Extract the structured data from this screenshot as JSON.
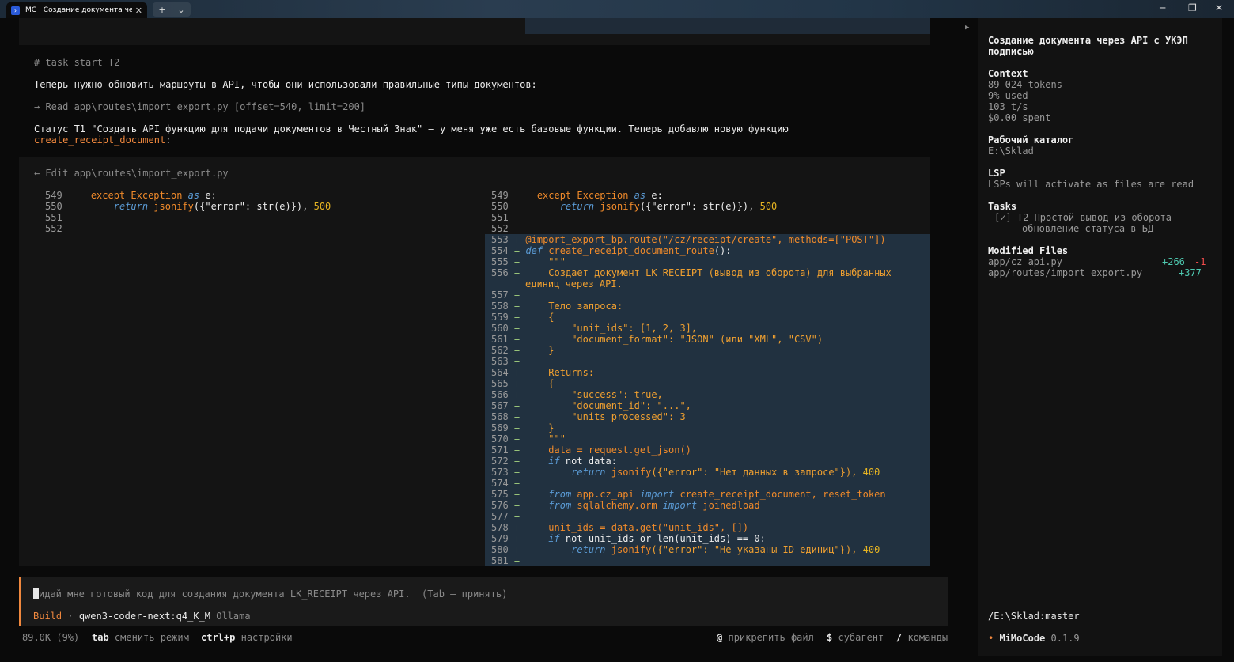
{
  "window": {
    "tab_title": "MC | Создание документа чер",
    "tab_close": "✕",
    "new_tab": "+",
    "dropdown": "⌄",
    "minimize": "─",
    "maximize": "❐",
    "close": "✕"
  },
  "chat": {
    "task_start": "# task start T2",
    "msg1": "Теперь нужно обновить маршруты в API, чтобы они использовали правильные типы документов:",
    "read_line": "→ Read app\\routes\\import_export.py [offset=540, limit=200]",
    "status_line": "Статус T1 \"Создать API функцию для подачи документов в Честный Знак\" — у меня уже есть базовые функции. Теперь добавлю новую функцию",
    "status_fn": "create_receipt_document",
    "status_colon": ":",
    "edit_header": "← Edit app\\routes\\import_export.py"
  },
  "diff": {
    "left_nums": [
      "549",
      "550",
      "551",
      "552"
    ],
    "right_nums": [
      "549",
      "550",
      "551",
      "552"
    ],
    "added_lines": [
      "553",
      "554",
      "555",
      "556",
      "",
      "557",
      "558",
      "559",
      "560",
      "561",
      "562",
      "563",
      "564",
      "565",
      "566",
      "567",
      "568",
      "569",
      "570",
      "571",
      "572",
      "573",
      "574",
      "575",
      "576",
      "577",
      "578",
      "579",
      "580",
      "581"
    ],
    "plus": "+",
    "exc_kw": "except",
    "exc_type": "Exception",
    "as_kw": "as",
    "exc_var": "e:",
    "ret_kw": "return",
    "jsonify": "jsonify",
    "err_tail": "({\"error\": str(e)}), ",
    "code500": "500",
    "decorator": "@import_export_bp.route(\"/cz/receipt/create\", methods=[\"POST\"])",
    "def_kw": "def",
    "def_name": "create_receipt_document_route",
    "def_tail": "():",
    "doc_q": "\"\"\"",
    "doc1": "Создает документ LK_RECEIPT (вывод из оборота) для выбранных",
    "doc1b": "единиц через API.",
    "doc_body": "Тело запроса:",
    "brace_open": "{",
    "unit_ids": "\"unit_ids\": [1, 2, 3],",
    "doc_format": "\"document_format\": \"JSON\" (или \"XML\", \"CSV\")",
    "brace_close": "}",
    "returns": "Returns:",
    "success": "\"success\": true,",
    "document_id": "\"document_id\": \"...\",",
    "units_processed": "\"units_processed\": 3",
    "data_assign": "data = request.get_json()",
    "if_kw": "if",
    "not_data": " not data:",
    "err_nodata": "({\"error\": \"Нет данных в запросе\"}), ",
    "code400": "400",
    "from_kw": "from",
    "import_kw": "import",
    "imp1_mod": " app.cz_api ",
    "imp1_names": " create_receipt_document, reset_token",
    "imp2_mod": " sqlalchemy.orm ",
    "imp2_names": " joinedload",
    "unit_ids_assign": "unit_ids = data.get(\"unit_ids\", [])",
    "if_unit": " not unit_ids or len(unit_ids) == 0:",
    "err_noids": "({\"error\": \"Не указаны ID единиц\"}), "
  },
  "input": {
    "typed_first": "К",
    "placeholder": "идай мне готовый код для создания документа LK_RECEIPT через API.  (Tab — принять)",
    "mode": "Build",
    "sep": "·",
    "model": "qwen3-coder-next:q4_K_M",
    "provider": "Ollama"
  },
  "footer": {
    "usage": "89.0K (9%)",
    "k_tab": "tab",
    "t_tab": "сменить режим",
    "k_ctrl": "ctrl+p",
    "t_ctrl": "настройки",
    "k_at": "@",
    "t_at": "прикрепить файл",
    "k_dollar": "$",
    "t_dollar": "субагент",
    "k_slash": "/",
    "t_slash": "команды"
  },
  "sidebar": {
    "collapse": "▶",
    "title1": "Создание документа через API с УКЭП",
    "title2": "подписью",
    "context_h": "Context",
    "tokens": "89 024 tokens",
    "used": "9% used",
    "rate": "103 t/s",
    "spent": "$0.00 spent",
    "workdir_h": "Рабочий каталог",
    "workdir": "E:\\Sklad",
    "lsp_h": "LSP",
    "lsp": "LSPs will activate as files are read",
    "tasks_h": "Tasks",
    "task1": "[✓] T2 Простой вывод из оборота –",
    "task1b": "обновление статуса в БД",
    "modified_h": "Modified Files",
    "file1": "app/cz_api.py",
    "file1_add": "+266",
    "file1_del": "-1",
    "file2": "app/routes/import_export.py",
    "file2_add": "+377",
    "branch": "/E:\\Sklad:master",
    "bullet": "•",
    "brand": "MiMoCode",
    "version": "0.1.9"
  },
  "colors": {
    "accent": "#f0883e",
    "added_bg": "#213140",
    "keyword_blue": "#5b9bd5",
    "string": "#f0a030",
    "number": "#e6b422",
    "plus_green": "#98c379",
    "diff_add": "#4ec9b0",
    "diff_del": "#f14c4c"
  }
}
